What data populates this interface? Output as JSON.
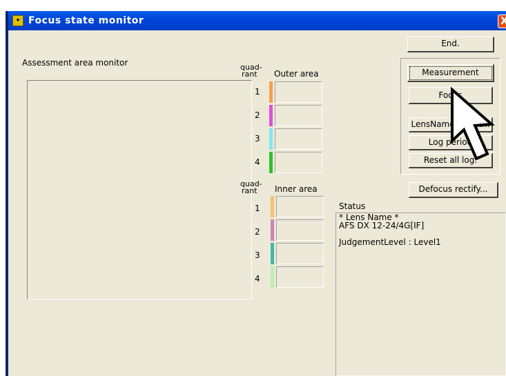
{
  "window": {
    "title": "Focus state monitor",
    "close_glyph": "X"
  },
  "assessment": {
    "label": "Assessment area monitor"
  },
  "quadrant": {
    "label_line1": "quad-",
    "label_line2": "rant"
  },
  "outer": {
    "label": "Outer area",
    "rows": [
      {
        "num": "1",
        "color": "#f4a050"
      },
      {
        "num": "2",
        "color": "#e050d8"
      },
      {
        "num": "3",
        "color": "#80e8f0"
      },
      {
        "num": "4",
        "color": "#30c030"
      }
    ]
  },
  "inner": {
    "label": "Inner area",
    "rows": [
      {
        "num": "1",
        "color": "#f8c070"
      },
      {
        "num": "2",
        "color": "#d080c0"
      },
      {
        "num": "3",
        "color": "#40b8a8"
      },
      {
        "num": "4",
        "color": "#b8f0b0"
      }
    ]
  },
  "buttons": {
    "end": "End.",
    "measurement": "Measurement",
    "focus": "Focus",
    "lens_select": "LensName select...",
    "log_period": "Log period",
    "reset_log": "Reset all log.",
    "defocus": "Defocus rectify..."
  },
  "status": {
    "label": "Status",
    "lines": [
      "* Lens Name *",
      "AFS DX 12-24/4G[IF]",
      "",
      "JudgementLevel : Level1"
    ]
  },
  "icons": {
    "app": "app-icon",
    "cursor": "mouse-cursor-icon"
  }
}
